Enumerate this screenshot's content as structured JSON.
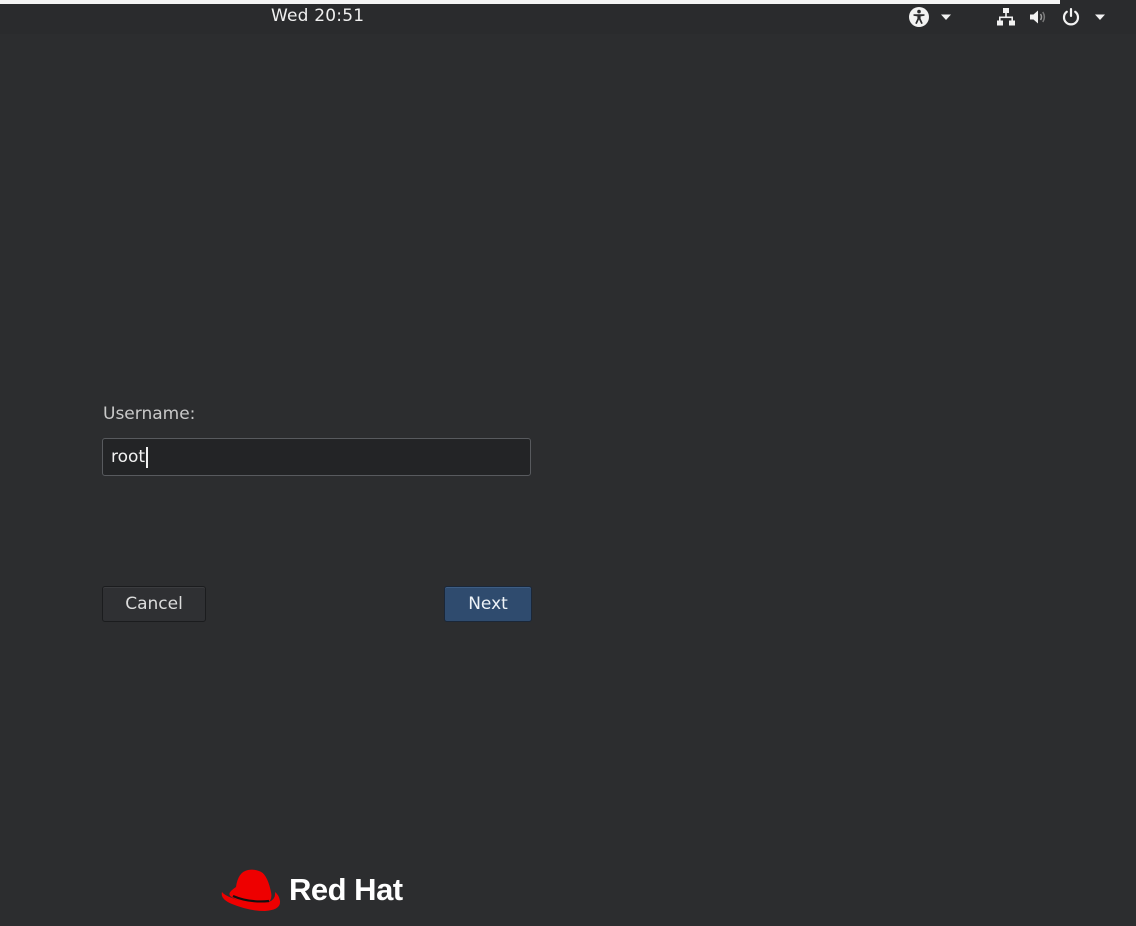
{
  "top_bar": {
    "clock": "Wed 20:51",
    "status_icons": [
      "accessibility-icon",
      "network-wired-icon",
      "volume-icon",
      "power-icon"
    ]
  },
  "login": {
    "username_label": "Username:",
    "username_value": "root",
    "cancel_label": "Cancel",
    "next_label": "Next"
  },
  "branding": {
    "logo_text": "Red Hat",
    "logo_color": "#ee0000"
  },
  "colors": {
    "background": "#2c2d2f",
    "primary_button": "#2f4b6e"
  }
}
